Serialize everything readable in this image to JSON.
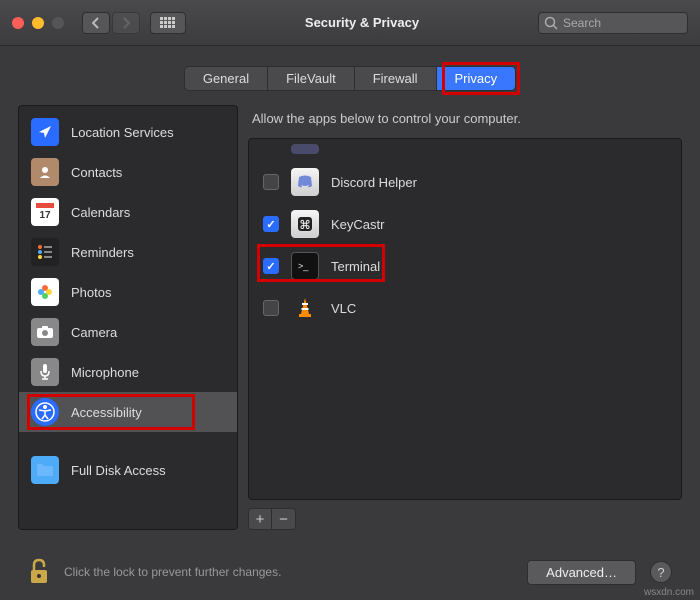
{
  "window": {
    "title": "Security & Privacy"
  },
  "search": {
    "placeholder": "Search"
  },
  "tabs": [
    {
      "label": "General"
    },
    {
      "label": "FileVault"
    },
    {
      "label": "Firewall"
    },
    {
      "label": "Privacy"
    }
  ],
  "sidebar": {
    "items": [
      {
        "label": "Location Services",
        "icon": "location"
      },
      {
        "label": "Contacts",
        "icon": "contacts"
      },
      {
        "label": "Calendars",
        "icon": "calendar"
      },
      {
        "label": "Reminders",
        "icon": "reminders"
      },
      {
        "label": "Photos",
        "icon": "photos"
      },
      {
        "label": "Camera",
        "icon": "camera"
      },
      {
        "label": "Microphone",
        "icon": "microphone"
      },
      {
        "label": "Accessibility",
        "icon": "accessibility"
      },
      {
        "label": "Full Disk Access",
        "icon": "folder"
      }
    ],
    "selected": 7
  },
  "main": {
    "instruction": "Allow the apps below to control your computer.",
    "apps": [
      {
        "name": "Discord Helper",
        "checked": false,
        "icon": "discord"
      },
      {
        "name": "KeyCastr",
        "checked": true,
        "icon": "keycastr"
      },
      {
        "name": "Terminal",
        "checked": true,
        "icon": "terminal"
      },
      {
        "name": "VLC",
        "checked": false,
        "icon": "vlc"
      }
    ]
  },
  "footer": {
    "lock_text": "Click the lock to prevent further changes.",
    "advanced": "Advanced…"
  },
  "watermark": "wsxdn.com"
}
